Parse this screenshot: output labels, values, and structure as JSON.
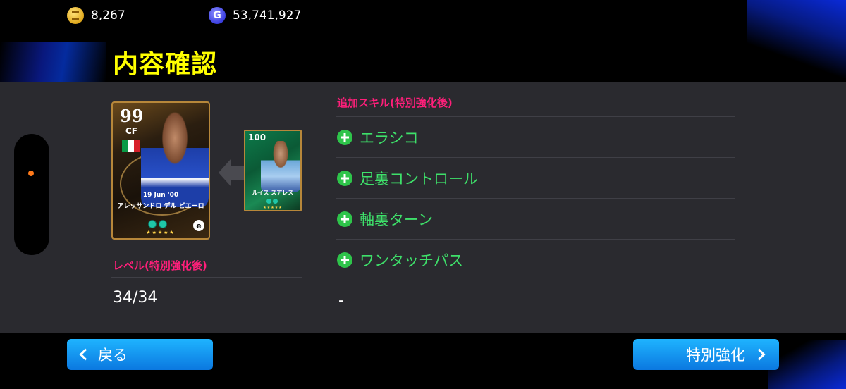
{
  "currency": {
    "coins_icon": "coin-icon",
    "coins": "8,267",
    "gp_icon": "gp-icon",
    "gp_symbol": "G",
    "gp": "53,741,927"
  },
  "title": "内容確認",
  "main_card": {
    "rating": "99",
    "position": "CF",
    "date": "19 Jun '00",
    "name": "アレッサンドロ デル ピエーロ",
    "stars": "★★★★★",
    "logo": "e",
    "flag_colors": [
      "#0a9a46",
      "#ffffff",
      "#d8202a"
    ]
  },
  "sub_card": {
    "rating": "100",
    "name": "ルイス スアレス",
    "stars": "★★★★★"
  },
  "level": {
    "label": "レベル(特別強化後)",
    "value": "34/34"
  },
  "skills": {
    "label": "追加スキル(特別強化後)",
    "items": [
      "エラシコ",
      "足裏コントロール",
      "軸裏ターン",
      "ワンタッチパス"
    ],
    "empty": "-"
  },
  "buttons": {
    "back": "戻る",
    "confirm": "特別強化"
  },
  "colors": {
    "title": "#ffff00",
    "section_label": "#ff1f7a",
    "skill_text": "#3ee06a",
    "button": "#0b78e0",
    "panel": "#2a2a2f"
  }
}
